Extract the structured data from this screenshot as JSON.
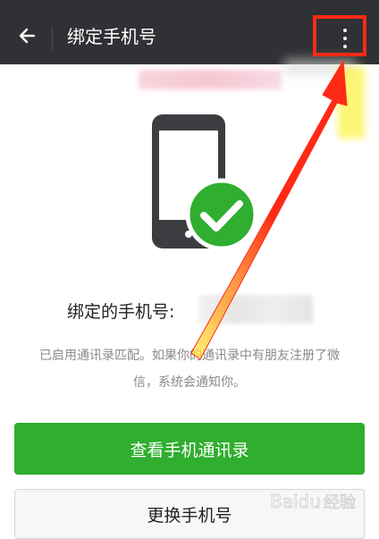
{
  "header": {
    "title": "绑定手机号",
    "back_icon": "arrow-left-icon",
    "more_icon": "more-vertical-icon"
  },
  "main": {
    "bound_label": "绑定的手机号:",
    "description_line1": "已启用通讯录匹配。如果你的通讯录中有朋友注册了微",
    "description_line2": "信，系统会通知你。",
    "primary_button": "查看手机通讯录",
    "secondary_button": "更换手机号"
  },
  "colors": {
    "header_bg": "#2f3134",
    "accent_green": "#2fae2f",
    "highlight_red": "#ff2a16"
  },
  "watermark": "Baidu 经验"
}
